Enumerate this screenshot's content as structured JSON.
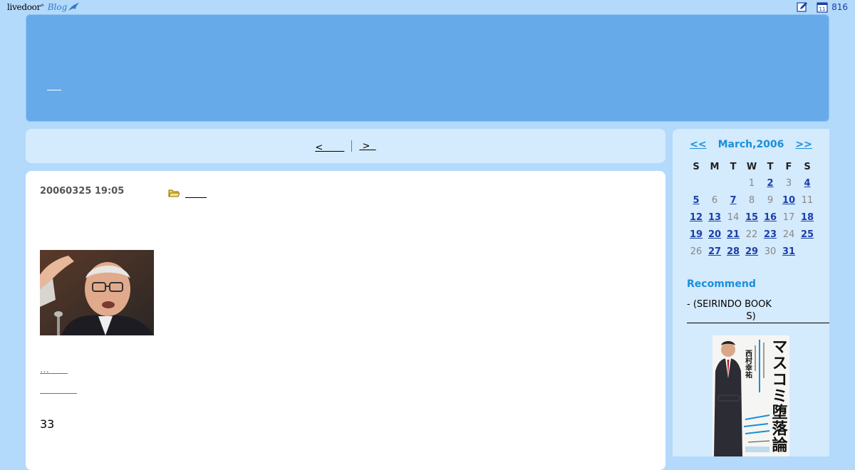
{
  "topbar": {
    "logo_livedoor": "livedoor",
    "logo_blog": "Blog",
    "counter": "816"
  },
  "nav": {
    "prev": "<　　 ",
    "next": " >  "
  },
  "entry": {
    "date": "20060325 19:05",
    "category": "　　 ",
    "link1": "…　　",
    "link2": "　　　　",
    "number": "33"
  },
  "calendar": {
    "prev": "<<",
    "next": ">>",
    "month": "March,2006",
    "weekdays": [
      "S",
      "M",
      "T",
      "W",
      "T",
      "F",
      "S"
    ],
    "weeks": [
      [
        {
          "d": ""
        },
        {
          "d": ""
        },
        {
          "d": ""
        },
        {
          "d": "1"
        },
        {
          "d": "2",
          "link": true
        },
        {
          "d": "3"
        },
        {
          "d": "4",
          "link": true
        }
      ],
      [
        {
          "d": "5",
          "link": true
        },
        {
          "d": "6"
        },
        {
          "d": "7",
          "link": true
        },
        {
          "d": "8"
        },
        {
          "d": "9"
        },
        {
          "d": "10",
          "link": true
        },
        {
          "d": "11"
        }
      ],
      [
        {
          "d": "12",
          "link": true
        },
        {
          "d": "13",
          "link": true
        },
        {
          "d": "14"
        },
        {
          "d": "15",
          "link": true
        },
        {
          "d": "16",
          "link": true
        },
        {
          "d": "17"
        },
        {
          "d": "18",
          "link": true
        }
      ],
      [
        {
          "d": "19",
          "link": true
        },
        {
          "d": "20",
          "link": true
        },
        {
          "d": "21",
          "link": true
        },
        {
          "d": "22"
        },
        {
          "d": "23",
          "link": true
        },
        {
          "d": "24"
        },
        {
          "d": "25",
          "link": true
        }
      ],
      [
        {
          "d": "26"
        },
        {
          "d": "27",
          "link": true
        },
        {
          "d": "28",
          "link": true
        },
        {
          "d": "29",
          "link": true
        },
        {
          "d": "30"
        },
        {
          "d": "31",
          "link": true
        },
        {
          "d": ""
        }
      ]
    ]
  },
  "recommend": {
    "title": "Recommend",
    "item_line1": "- (SEIRINDO BOOK",
    "item_line2": "S)",
    "book_title": "マスコミ堕落論",
    "book_author": "西村幸祐"
  },
  "colors": {
    "background": "#b3d9fb",
    "banner": "#66aaea",
    "panel": "#d4eafd",
    "accent": "#1a8fd8"
  }
}
